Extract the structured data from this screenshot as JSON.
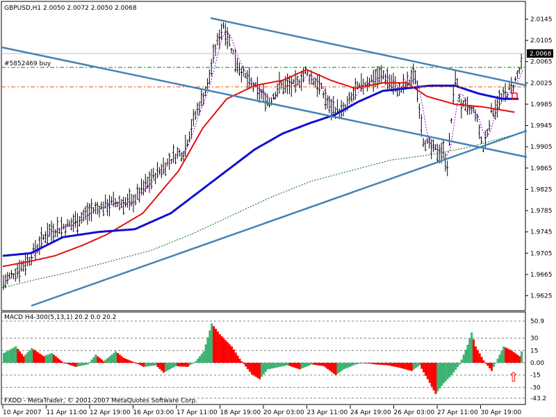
{
  "window": {
    "symbol_line": "GBPUSD,H1  2.0050 2.0072 2.0050 2.0068",
    "order_label": "#5852469 buy",
    "copyright": "FXDD - MetaTrader, © 2001-2007 MetaQuotes Software Corp.",
    "indicator_line": "MACD H4-300(5,13,1) 20.2 0.0 20.2"
  },
  "colors": {
    "background": "#ffffff",
    "grid": "#c0c0c0",
    "bars": "#000000",
    "trendline": "#4682b4",
    "ma_fast": "#9400d3",
    "ma_red": "#e01010",
    "ma_blue": "#1010d0",
    "ma_green": "#006400",
    "order_line_green": "#008000",
    "order_line_red": "#ff4500",
    "macd_up": "#3cb371",
    "macd_down": "#ff0000",
    "signal_arrow": "#ff0000",
    "price_label_bg": "#000000",
    "price_label_fg": "#ffffff"
  },
  "chart_data": {
    "type": "line",
    "symbol": "GBPUSD",
    "timeframe": "H1",
    "ohlc_header": {
      "open": 2.005,
      "high": 2.0072,
      "low": 2.005,
      "close": 2.0068
    },
    "current_price_label": "2.0068",
    "y_ticks": [
      "2.0145",
      "2.0105",
      "2.0065",
      "2.0025",
      "1.9985",
      "1.9945",
      "1.9905",
      "1.9865",
      "1.9825",
      "1.9785",
      "1.9745",
      "1.9705",
      "1.9665",
      "1.9625"
    ],
    "ylim": [
      1.961,
      2.016
    ],
    "x_ticks": [
      "10 Apr 2007",
      "11 Apr 11:00",
      "12 Apr 19:00",
      "16 Apr 03:00",
      "17 Apr 11:00",
      "18 Apr 19:00",
      "20 Apr 03:00",
      "23 Apr 11:00",
      "24 Apr 19:00",
      "26 Apr 03:00",
      "27 Apr 11:00",
      "30 Apr 19:00"
    ],
    "grid": true,
    "bar_count": 260,
    "price_path": [
      [
        0,
        1.965
      ],
      [
        12,
        1.969
      ],
      [
        22,
        1.9745
      ],
      [
        34,
        1.976
      ],
      [
        44,
        1.9785
      ],
      [
        55,
        1.98
      ],
      [
        64,
        1.98
      ],
      [
        74,
        1.9845
      ],
      [
        86,
        1.989
      ],
      [
        90,
        1.9895
      ],
      [
        96,
        1.9965
      ],
      [
        102,
        2.002
      ],
      [
        106,
        2.009
      ],
      [
        110,
        2.0135
      ],
      [
        116,
        2.007
      ],
      [
        120,
        2.004
      ],
      [
        127,
        2.001
      ],
      [
        133,
        1.999
      ],
      [
        138,
        2.002
      ],
      [
        146,
        2.002
      ],
      [
        151,
        2.0045
      ],
      [
        158,
        2.002
      ],
      [
        163,
        1.998
      ],
      [
        170,
        1.997
      ],
      [
        176,
        2.001
      ],
      [
        183,
        2.003
      ],
      [
        190,
        2.004
      ],
      [
        198,
        2.001
      ],
      [
        206,
        2.004
      ],
      [
        210,
        1.992
      ],
      [
        214,
        1.99
      ],
      [
        220,
        1.9895
      ],
      [
        222,
        1.987
      ],
      [
        226,
        2.004
      ],
      [
        229,
        1.998
      ],
      [
        236,
        1.997
      ],
      [
        240,
        1.99
      ],
      [
        244,
        1.997
      ],
      [
        250,
        2.0
      ],
      [
        255,
        2.002
      ],
      [
        260,
        2.0068
      ]
    ],
    "series": [
      {
        "values_path": [
          [
            0,
            1.968
          ],
          [
            14,
            1.969
          ],
          [
            26,
            1.97
          ],
          [
            40,
            1.972
          ],
          [
            52,
            1.974
          ],
          [
            70,
            1.978
          ],
          [
            88,
            1.986
          ],
          [
            100,
            1.994
          ],
          [
            112,
            1.9995
          ],
          [
            126,
            2.002
          ],
          [
            140,
            2.003
          ],
          [
            152,
            2.005
          ],
          [
            164,
            2.003
          ],
          [
            176,
            2.0015
          ],
          [
            190,
            2.0025
          ],
          [
            202,
            2.0025
          ],
          [
            212,
            2.0
          ],
          [
            226,
            1.9985
          ],
          [
            240,
            1.998
          ],
          [
            256,
            1.997
          ]
        ]
      },
      {
        "values_path": [
          [
            0,
            1.97
          ],
          [
            14,
            1.9705
          ],
          [
            30,
            1.9735
          ],
          [
            48,
            1.9745
          ],
          [
            66,
            1.975
          ],
          [
            84,
            1.978
          ],
          [
            98,
            1.982
          ],
          [
            112,
            1.986
          ],
          [
            126,
            1.99
          ],
          [
            140,
            1.993
          ],
          [
            154,
            1.995
          ],
          [
            166,
            1.9965
          ],
          [
            178,
            1.999
          ],
          [
            190,
            2.001
          ],
          [
            202,
            2.0015
          ],
          [
            214,
            2.002
          ],
          [
            226,
            2.002
          ],
          [
            238,
            2.0005
          ],
          [
            250,
            1.9995
          ],
          [
            258,
            1.9995
          ]
        ]
      },
      {
        "values_path": [
          [
            0,
            1.964
          ],
          [
            16,
            1.9655
          ],
          [
            34,
            1.967
          ],
          [
            54,
            1.969
          ],
          [
            74,
            1.971
          ],
          [
            94,
            1.974
          ],
          [
            114,
            1.9775
          ],
          [
            134,
            1.981
          ],
          [
            154,
            1.984
          ],
          [
            174,
            1.986
          ],
          [
            194,
            1.988
          ],
          [
            214,
            1.989
          ],
          [
            234,
            1.9905
          ],
          [
            258,
            1.993
          ]
        ]
      }
    ],
    "macd": {
      "title": "MACD H4-300(5,13,1) 20.2 0.0 20.2",
      "y_ticks": [
        "50.9",
        "30",
        "15",
        "0.00",
        "-15",
        "-30",
        "-43.2"
      ],
      "ylim": [
        -43.2,
        50.9
      ],
      "path": [
        [
          0,
          12
        ],
        [
          6,
          20
        ],
        [
          10,
          8
        ],
        [
          14,
          18
        ],
        [
          20,
          8
        ],
        [
          24,
          12
        ],
        [
          30,
          0
        ],
        [
          36,
          -5
        ],
        [
          42,
          -2
        ],
        [
          46,
          10
        ],
        [
          50,
          2
        ],
        [
          56,
          14
        ],
        [
          60,
          6
        ],
        [
          66,
          0
        ],
        [
          70,
          -5
        ],
        [
          76,
          -3
        ],
        [
          80,
          -12
        ],
        [
          86,
          -4
        ],
        [
          92,
          -5
        ],
        [
          96,
          2
        ],
        [
          100,
          14
        ],
        [
          104,
          48
        ],
        [
          108,
          35
        ],
        [
          114,
          20
        ],
        [
          118,
          5
        ],
        [
          124,
          -14
        ],
        [
          128,
          -20
        ],
        [
          132,
          -8
        ],
        [
          138,
          -5
        ],
        [
          142,
          -3
        ],
        [
          148,
          -8
        ],
        [
          154,
          -2
        ],
        [
          160,
          -4
        ],
        [
          166,
          -15
        ],
        [
          170,
          -8
        ],
        [
          176,
          -2
        ],
        [
          180,
          0
        ],
        [
          186,
          -2
        ],
        [
          192,
          -3
        ],
        [
          198,
          -6
        ],
        [
          204,
          -10
        ],
        [
          208,
          -3
        ],
        [
          212,
          -20
        ],
        [
          216,
          -38
        ],
        [
          220,
          -25
        ],
        [
          224,
          -15
        ],
        [
          228,
          -2
        ],
        [
          232,
          22
        ],
        [
          234,
          37
        ],
        [
          236,
          20
        ],
        [
          240,
          3
        ],
        [
          244,
          -10
        ],
        [
          250,
          20
        ],
        [
          254,
          15
        ],
        [
          258,
          8
        ],
        [
          260,
          20
        ]
      ]
    }
  },
  "signal": {
    "arrow": "⇧",
    "name": "buy-arrow"
  }
}
